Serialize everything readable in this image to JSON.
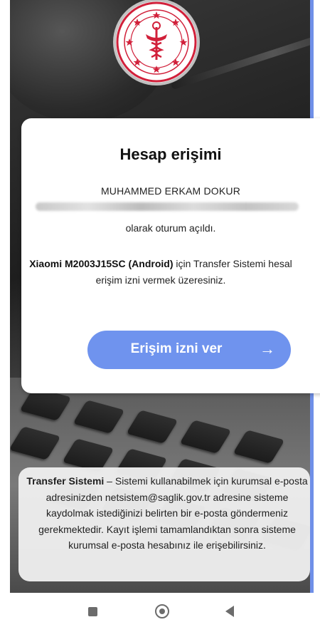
{
  "colors": {
    "accent": "#6f93ee",
    "right_edge": "#6f8fe8",
    "logo_red": "#d1203a",
    "nav_icon": "#6c6c6c"
  },
  "logo": {
    "icon": "ministry-of-health-seal"
  },
  "card": {
    "title": "Hesap erişimi",
    "user_name": "MUHAMMED ERKAM DOKUR",
    "signed_in": "olarak oturum açıldı.",
    "device": "Xiaomi M2003J15SC (Android)",
    "access_line1_rest": " için Transfer Sistemi hesal",
    "access_line2": "erişim izni vermek üzeresiniz.",
    "grant_button": "Erişim izni ver",
    "grant_arrow": "→"
  },
  "info": {
    "system_name": "Transfer Sistemi",
    "body": " – Sistemi kullanabilmek için kurumsal e-posta adresinizden netsistem@saglik.gov.tr adresine sisteme kaydolmak istediğinizi belirten bir e-posta göndermeniz gerekmektedir. Kayıt işlemi tamamlandıktan sonra sisteme kurumsal e-posta hesabınız ile erişebilirsiniz."
  },
  "navbar": {
    "icons": [
      "recents-square-icon",
      "home-circle-icon",
      "back-triangle-icon"
    ]
  }
}
